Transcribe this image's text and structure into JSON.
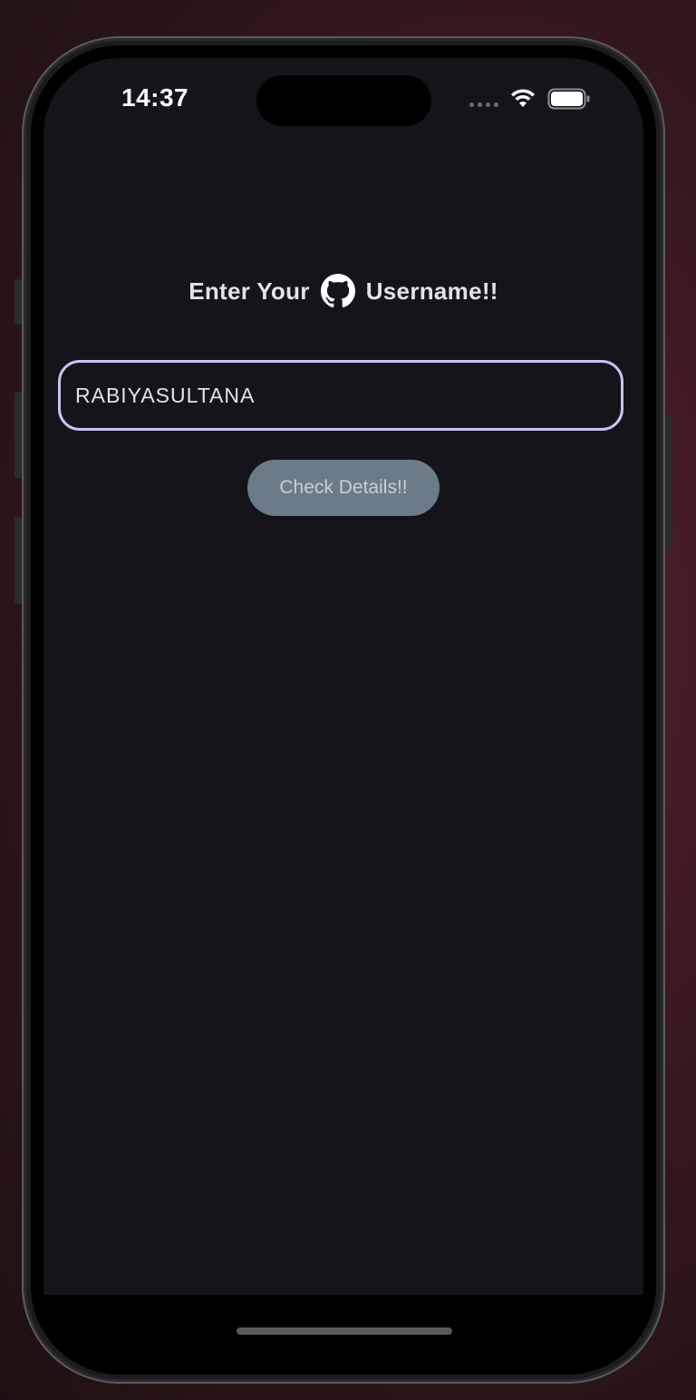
{
  "status_bar": {
    "time": "14:37",
    "signal_icon": "cellular-dots-icon",
    "wifi_icon": "wifi-icon",
    "battery_icon": "battery-full-icon"
  },
  "main": {
    "heading_prefix": "Enter Your",
    "heading_icon": "github-icon",
    "heading_suffix": "Username!!",
    "username_value": "RABIYASULTANA",
    "check_button_label": "Check Details!!"
  },
  "colors": {
    "screen_background": "#16141b",
    "field_border": "#cfc0f0",
    "button_background": "#6b7c88",
    "text": "#e6e1ea"
  }
}
